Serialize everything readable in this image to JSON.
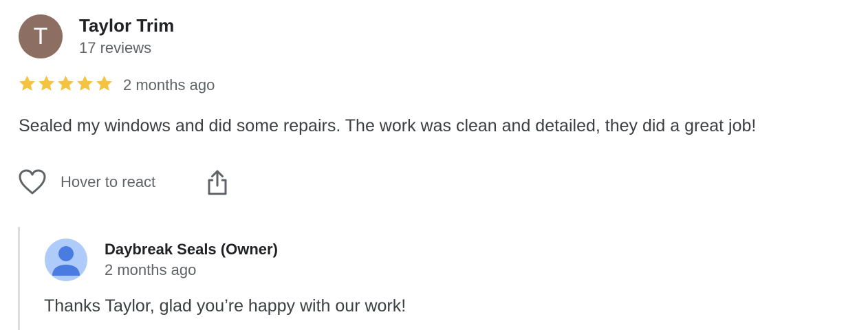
{
  "review": {
    "avatar_initial": "T",
    "avatar_color": "#8d6e63",
    "reviewer_name": "Taylor Trim",
    "review_count": "17 reviews",
    "rating": 5,
    "rating_max": 5,
    "star_color": "#f4c33f",
    "date": "2 months ago",
    "text": "Sealed my windows and did some repairs. The work was clean and detailed, they did a great job!"
  },
  "actions": {
    "react_icon": "heart-outline-icon",
    "react_label": "Hover to react",
    "share_icon": "share-icon"
  },
  "owner_reply": {
    "avatar_icon": "default-person-icon",
    "avatar_color": "#aecbfa",
    "name": "Daybreak Seals (Owner)",
    "date": "2 months ago",
    "text": "Thanks Taylor, glad you’re happy with our work!"
  }
}
